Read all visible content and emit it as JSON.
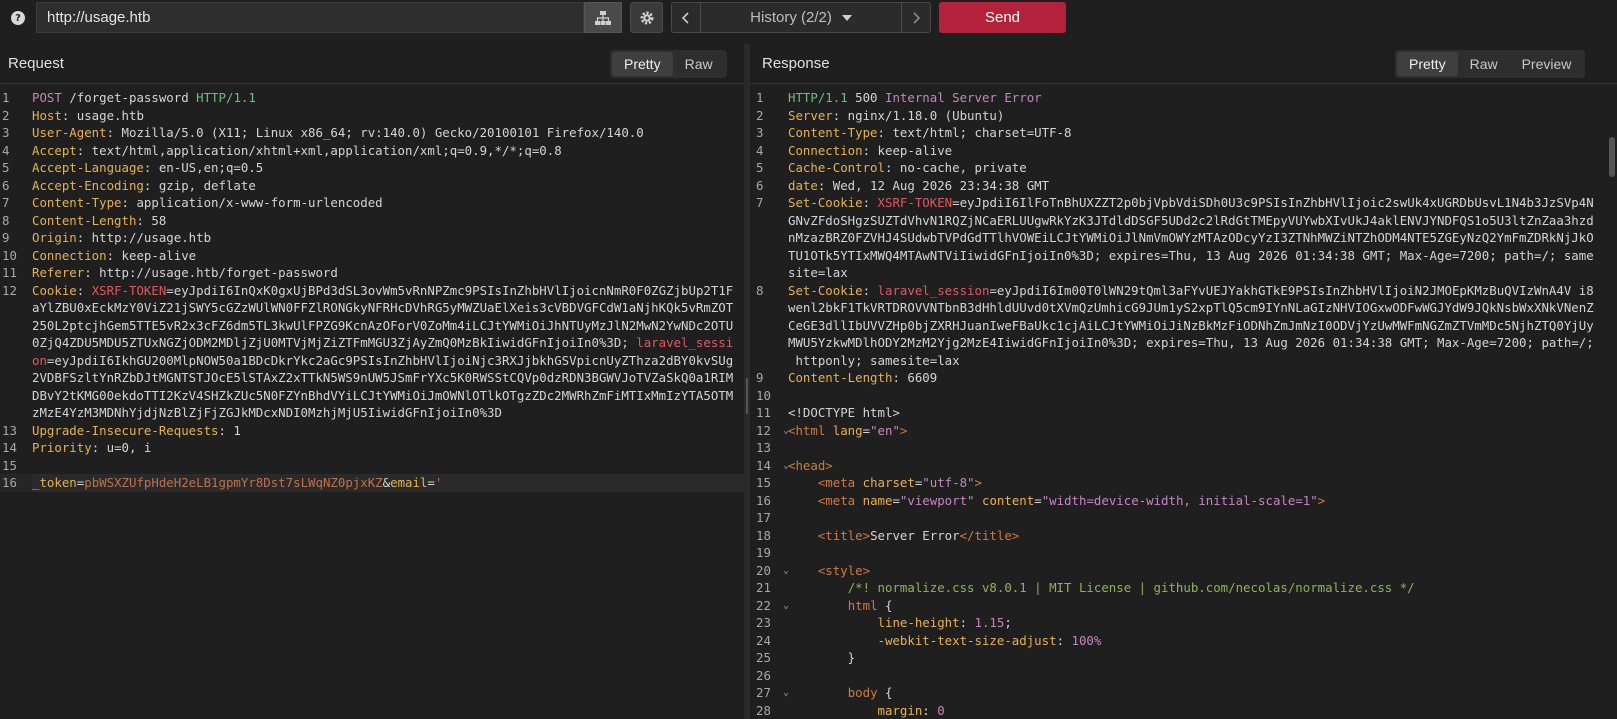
{
  "toolbar": {
    "help_glyph": "?",
    "url_value": "http://usage.htb",
    "history_label": "History (2/2)",
    "send_label": "Send"
  },
  "request": {
    "title": "Request",
    "tabs": [
      "Pretty",
      "Raw"
    ],
    "active_tab": "Pretty",
    "lines": [
      [
        [
          "m",
          "POST "
        ],
        [
          "t",
          "/forget-password "
        ],
        [
          "g",
          "HTTP/1.1"
        ]
      ],
      [
        [
          "k",
          "Host"
        ],
        [
          "t",
          ": usage.htb"
        ]
      ],
      [
        [
          "k",
          "User-Agent"
        ],
        [
          "t",
          ": Mozilla/5.0 (X11; Linux x86_64; rv:140.0) Gecko/20100101 Firefox/140.0"
        ]
      ],
      [
        [
          "k",
          "Accept"
        ],
        [
          "t",
          ": text/html,application/xhtml+xml,application/xml;q=0.9,*/*;q=0.8"
        ]
      ],
      [
        [
          "k",
          "Accept-Language"
        ],
        [
          "t",
          ": en-US,en;q=0.5"
        ]
      ],
      [
        [
          "k",
          "Accept-Encoding"
        ],
        [
          "t",
          ": gzip, deflate"
        ]
      ],
      [
        [
          "k",
          "Content-Type"
        ],
        [
          "t",
          ": application/x-www-form-urlencoded"
        ]
      ],
      [
        [
          "k",
          "Content-Length"
        ],
        [
          "t",
          ": 58"
        ]
      ],
      [
        [
          "k",
          "Origin"
        ],
        [
          "t",
          ": http://usage.htb"
        ]
      ],
      [
        [
          "k",
          "Connection"
        ],
        [
          "t",
          ": keep-alive"
        ]
      ],
      [
        [
          "k",
          "Referer"
        ],
        [
          "t",
          ": http://usage.htb/forget-password"
        ]
      ],
      [
        [
          "k",
          "Cookie"
        ],
        [
          "t",
          ": "
        ],
        [
          "r",
          "XSRF-TOKEN"
        ],
        [
          "t",
          "=eyJpdiI6InQxK0gxUjBPd3dSL3ovWm5vRnNPZmc9PSIsInZhbHVlIjoicnNmR0F0ZGZjbUp2T1FaYlZBU0xEckMzY0ViZ21jSWY5cGZzWUlWN0FFZlRONGkyNFRHcDVhRG5yMWZUaElXeis3cVBDVGFCdW1aNjhKQk5vRmZOT250L2ptcjhGem5TTE5vR2x3cFZ6dm5TL3kwUlFPZG9KcnAzOForV0ZoMm4iLCJtYWMiOiJhNTUyMzJlN2MwN2YwNDc2OTU0ZjQ4ZDU5MDU5ZTUxNGZjODM2MDljZjU0MTVjMjZiZTFmMGU3ZjAyZmQ0MzBkIiwidGFnIjoiIn0%3D; "
        ],
        [
          "r",
          "laravel_session"
        ],
        [
          "t",
          "=eyJpdiI6IkhGU200MlpNOW50a1BDcDkrYkc2aGc9PSIsInZhbHVlIjoiNjc3RXJjbkhGSVpicnUyZThza2dBY0kvSUg2VDBFSzltYnRZbDJtMGNTSTJOcE5lSTAxZ2xTTkN5WS9nUW5JSmFrYXc5K0RWSStCQVp0dzRDN3BGWVJoTVZaSkQ0a1RIMDBvY2tKMG00ekdoTTI2KzV4SHZkZUc5N0FZYnBhdVYiLCJtYWMiOiJmOWNlOTlkOTgzZDc2MWRhZmFiMTIxMmIzYTA5OTMzMzE4YzM3MDNhYjdjNzBlZjFjZGJkMDcxNDI0MzhjMjU5IiwidGFnIjoiIn0%3D"
        ]
      ],
      [
        [
          "k",
          "Upgrade-Insecure-Requests"
        ],
        [
          "t",
          ": 1"
        ]
      ],
      [
        [
          "k",
          "Priority"
        ],
        [
          "t",
          ": u=0, i"
        ]
      ],
      [],
      [
        [
          "p",
          "_token"
        ],
        [
          "t",
          "="
        ],
        [
          "pv",
          "pbWSXZUfpHdeH2eLB1gpmYr8Dst7sLWqNZ0pjxKZ"
        ],
        [
          "t",
          "&"
        ],
        [
          "p",
          "email"
        ],
        [
          "t",
          "="
        ],
        [
          "pv",
          "'"
        ]
      ]
    ]
  },
  "response": {
    "title": "Response",
    "tabs": [
      "Pretty",
      "Raw",
      "Preview"
    ],
    "active_tab": "Pretty",
    "lines": [
      [
        [
          "g",
          "HTTP/1.1 "
        ],
        [
          "t",
          "500 "
        ],
        [
          "m",
          "Internal Server Error"
        ]
      ],
      [
        [
          "k",
          "Server"
        ],
        [
          "t",
          ": nginx/1.18.0 (Ubuntu)"
        ]
      ],
      [
        [
          "k",
          "Content-Type"
        ],
        [
          "t",
          ": text/html; charset=UTF-8"
        ]
      ],
      [
        [
          "k",
          "Connection"
        ],
        [
          "t",
          ": keep-alive"
        ]
      ],
      [
        [
          "k",
          "Cache-Control"
        ],
        [
          "t",
          ": no-cache, private"
        ]
      ],
      [
        [
          "k",
          "date"
        ],
        [
          "t",
          ": Wed, 12 Aug 2026 23:34:38 GMT"
        ]
      ],
      [
        [
          "k",
          "Set-Cookie"
        ],
        [
          "t",
          ": "
        ],
        [
          "r",
          "XSRF-TOKEN"
        ],
        [
          "t",
          "=eyJpdiI6IlFoTnBhUXZZT2p0bjVpbVdiSDh0U3c9PSIsInZhbHVlIjoic2swUk4xUGRDbUsvL1N4b3JzSVp4NGNvZFdoSHgzSUZTdVhvN1RQZjNCaERLUUgwRkYzK3JTdldDSGF5UDd2c2lRdGtTMEpyVUYwbXIvUkJ4aklENVJYNDFQS1o5U3ltZnZaa3hzdnMzazBRZ0FZVHJ4SUdwbTVPdGdTTlhVOWEiLCJtYWMiOiJlNmVmOWYzMTAzODcyYzI3ZTNhMWZiNTZhODM4NTE5ZGEyNzQ2YmFmZDRkNjJkOTU1OTk5YTIxMWQ4MTAwNTViIiwidGFnIjoiIn0%3D; expires=Thu, 13 Aug 2026 01:34:38 GMT; Max-Age=7200; path=/; samesite=lax"
        ]
      ],
      [
        [
          "k",
          "Set-Cookie"
        ],
        [
          "t",
          ": "
        ],
        [
          "r",
          "laravel_session"
        ],
        [
          "t",
          "=eyJpdiI6Im00T0lWN29tQml3aFYvUEJYakhGTkE9PSIsInZhbHVlIjoiN2JMOEpKMzBuQVIzWnA4V i8wenl2bkF1TkVRTDROVVNTbnB3dHhldUUvd0tXVmQzUmhicG9JUm1yS2xpTlQ5cm9IYnNLaGIzNHVIOGxwODFwWGJYdW9JQkNsbWxXNkVNenZCeGE3dllIbUVVZHp0bjZXRHJuanIweFBaUkc1cjAiLCJtYWMiOiJiNzBkMzFiODNhZmJmNzI0ODVjYzUwMWFmNGZmZTVmMDc5NjhZTQ0YjUyMWU5YzkwMDlhODY2MzM2Yjg2MzE4IiwidGFnIjoiIn0%3D; expires=Thu, 13 Aug 2026 01:34:38 GMT; Max-Age=7200; path=/; httponly; samesite=lax"
        ]
      ],
      [
        [
          "k",
          "Content-Length"
        ],
        [
          "t",
          ": 6609"
        ]
      ],
      [],
      [
        [
          "t",
          "<!DOCTYPE html>"
        ]
      ],
      [
        [
          "tag",
          "<html "
        ],
        [
          "attr",
          "lang"
        ],
        [
          "t",
          "="
        ],
        [
          "str",
          "\"en\""
        ],
        [
          "tag",
          ">"
        ]
      ],
      [],
      [
        [
          "tag",
          "<head>"
        ]
      ],
      [
        [
          "t",
          "    "
        ],
        [
          "tag",
          "<meta "
        ],
        [
          "attr",
          "charset"
        ],
        [
          "t",
          "="
        ],
        [
          "str",
          "\"utf-8\""
        ],
        [
          "tag",
          ">"
        ]
      ],
      [
        [
          "t",
          "    "
        ],
        [
          "tag",
          "<meta "
        ],
        [
          "attr",
          "name"
        ],
        [
          "t",
          "="
        ],
        [
          "str",
          "\"viewport\""
        ],
        [
          "t",
          " "
        ],
        [
          "attr",
          "content"
        ],
        [
          "t",
          "="
        ],
        [
          "str",
          "\"width=device-width, initial-scale=1\""
        ],
        [
          "tag",
          ">"
        ]
      ],
      [],
      [
        [
          "t",
          "    "
        ],
        [
          "tag",
          "<title>"
        ],
        [
          "t",
          "Server Error"
        ],
        [
          "tag",
          "</title>"
        ]
      ],
      [],
      [
        [
          "t",
          "    "
        ],
        [
          "tag",
          "<style>"
        ]
      ],
      [
        [
          "t",
          "        "
        ],
        [
          "cm",
          "/*! normalize.css v8.0.1 | MIT License | github.com/necolas/normalize.css */"
        ]
      ],
      [
        [
          "t",
          "        "
        ],
        [
          "tag",
          "html"
        ],
        [
          "t",
          " {"
        ]
      ],
      [
        [
          "t",
          "            "
        ],
        [
          "attr",
          "line-height"
        ],
        [
          "t",
          ": "
        ],
        [
          "num",
          "1.15"
        ],
        [
          "t",
          ";"
        ]
      ],
      [
        [
          "t",
          "            "
        ],
        [
          "attr",
          "-webkit-text-size-adjust"
        ],
        [
          "t",
          ": "
        ],
        [
          "num",
          "100%"
        ]
      ],
      [
        [
          "t",
          "        }"
        ]
      ],
      [],
      [
        [
          "t",
          "        "
        ],
        [
          "tag",
          "body"
        ],
        [
          "t",
          " {"
        ]
      ],
      [
        [
          "t",
          "            "
        ],
        [
          "attr",
          "margin"
        ],
        [
          "t",
          ": "
        ],
        [
          "num",
          "0"
        ]
      ]
    ],
    "fold_lines": [
      12,
      14,
      20,
      22,
      27
    ]
  }
}
